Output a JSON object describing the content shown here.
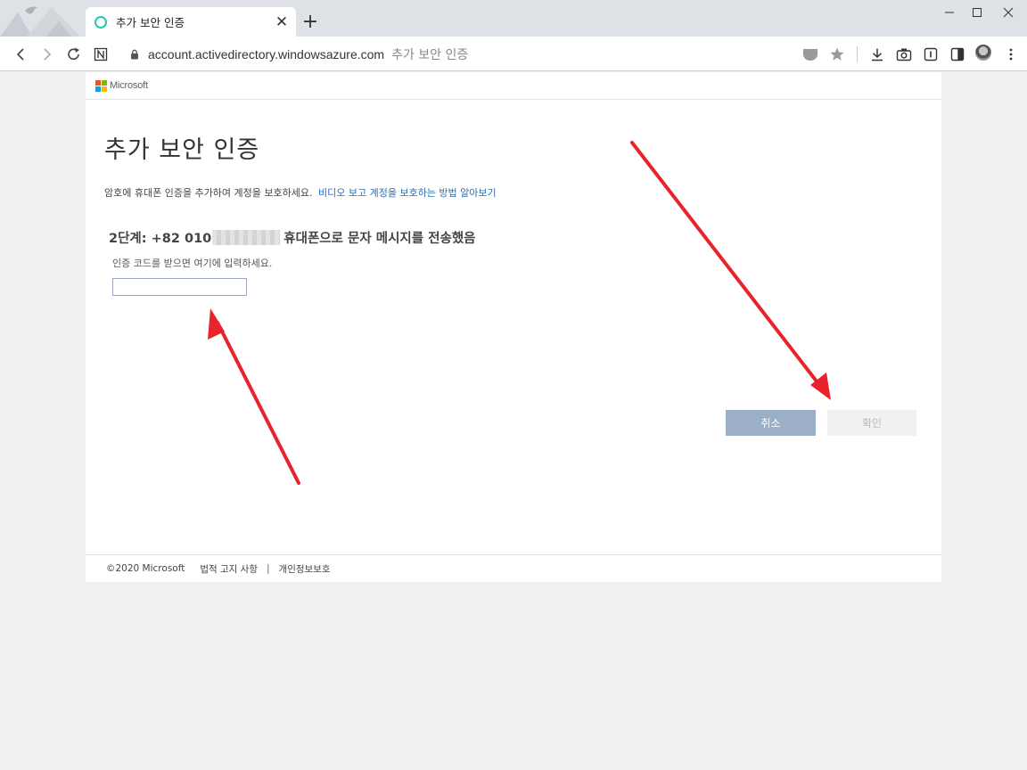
{
  "browser": {
    "tab_title": "추가 보안 인증",
    "new_tab": "+",
    "tab_close": "✕",
    "url_host": "account.activedirectory.windowsazure.com",
    "url_title": "추가 보안 인증"
  },
  "page": {
    "brand": "Microsoft",
    "heading": "추가 보안 인증",
    "intro_text": "암호에 휴대폰 인증을 추가하여 계정을 보호하세요.",
    "intro_link": "비디오 보고 계정을 보호하는 방법 알아보기",
    "step_prefix": "2단계: +82 010",
    "step_suffix": "휴대폰으로 문자 메시지를 전송했음",
    "instruction": "인증 코드를 받으면 여기에 입력하세요.",
    "code_value": "",
    "cancel_label": "취소",
    "confirm_label": "확인"
  },
  "footer": {
    "copyright": "©2020 Microsoft",
    "legal": "법적 고지 사항",
    "separator": "|",
    "privacy": "개인정보보호"
  },
  "colors": {
    "tab_favicon": "#1ec8b4",
    "link": "#2d6fb0",
    "cancel_button": "#9bb0c7",
    "confirm_button_disabled": "#f1f1f1",
    "arrow": "#e8232b",
    "ms_red": "#f25022",
    "ms_green": "#7fba00",
    "ms_blue": "#00a4ef",
    "ms_yellow": "#ffb900"
  }
}
